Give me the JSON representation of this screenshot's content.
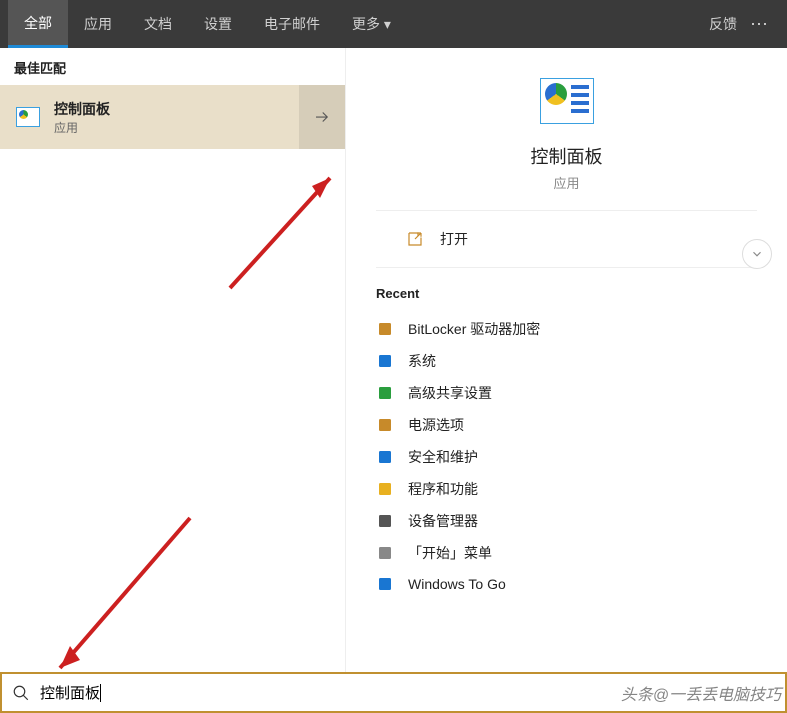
{
  "topbar": {
    "tabs": [
      "全部",
      "应用",
      "文档",
      "设置",
      "电子邮件",
      "更多"
    ],
    "more_glyph": "▾",
    "feedback": "反馈",
    "dots": "⋯"
  },
  "left": {
    "section": "最佳匹配",
    "result": {
      "title": "控制面板",
      "sub": "应用"
    }
  },
  "detail": {
    "title": "控制面板",
    "sub": "应用",
    "open_label": "打开",
    "recent_label": "Recent",
    "recent": [
      {
        "label": "BitLocker 驱动器加密",
        "color": "#c78a2a"
      },
      {
        "label": "系统",
        "color": "#1976d2"
      },
      {
        "label": "高级共享设置",
        "color": "#2a9e3e"
      },
      {
        "label": "电源选项",
        "color": "#c78a2a"
      },
      {
        "label": "安全和维护",
        "color": "#1976d2"
      },
      {
        "label": "程序和功能",
        "color": "#e8b020"
      },
      {
        "label": "设备管理器",
        "color": "#555"
      },
      {
        "label": "「开始」菜单",
        "color": "#888"
      },
      {
        "label": "Windows To Go",
        "color": "#1976d2"
      }
    ]
  },
  "search": {
    "value": "控制面板"
  },
  "watermark": "头条@一丢丢电脑技巧"
}
